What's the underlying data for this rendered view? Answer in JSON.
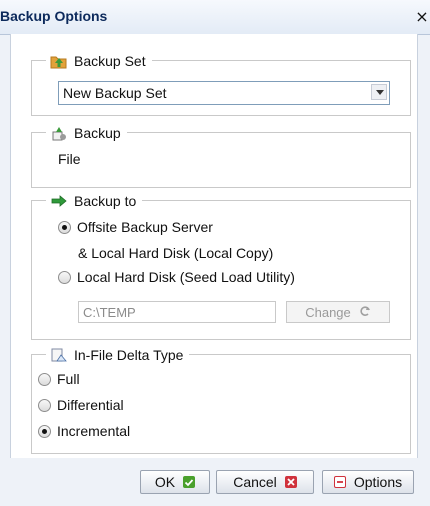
{
  "window": {
    "title": "Backup Options",
    "close_glyph": "×"
  },
  "backup_set": {
    "heading": "Backup Set",
    "icon": "folder-backup-icon",
    "selected": "New Backup Set"
  },
  "backup": {
    "heading": "Backup",
    "icon": "backup-type-icon",
    "value": "File"
  },
  "backup_to": {
    "heading": "Backup to",
    "icon": "backup-destination-icon",
    "options": [
      {
        "label": "Offsite Backup Server",
        "selected": true
      },
      {
        "label": "Local Hard Disk (Seed Load Utility)",
        "selected": false
      }
    ],
    "offsite_sub": "& Local Hard Disk (Local Copy)",
    "path_value": "C:\\TEMP",
    "change_label": "Change"
  },
  "delta": {
    "heading": "In-File Delta Type",
    "icon": "delta-type-icon",
    "options": [
      {
        "label": "Full",
        "selected": false
      },
      {
        "label": "Differential",
        "selected": false
      },
      {
        "label": "Incremental",
        "selected": true
      }
    ]
  },
  "buttons": {
    "ok": "OK",
    "cancel": "Cancel",
    "options": "Options"
  },
  "colors": {
    "ok_icon": "#4aa02c",
    "cancel_icon": "#d0323c",
    "options_icon": "#d0323c"
  }
}
